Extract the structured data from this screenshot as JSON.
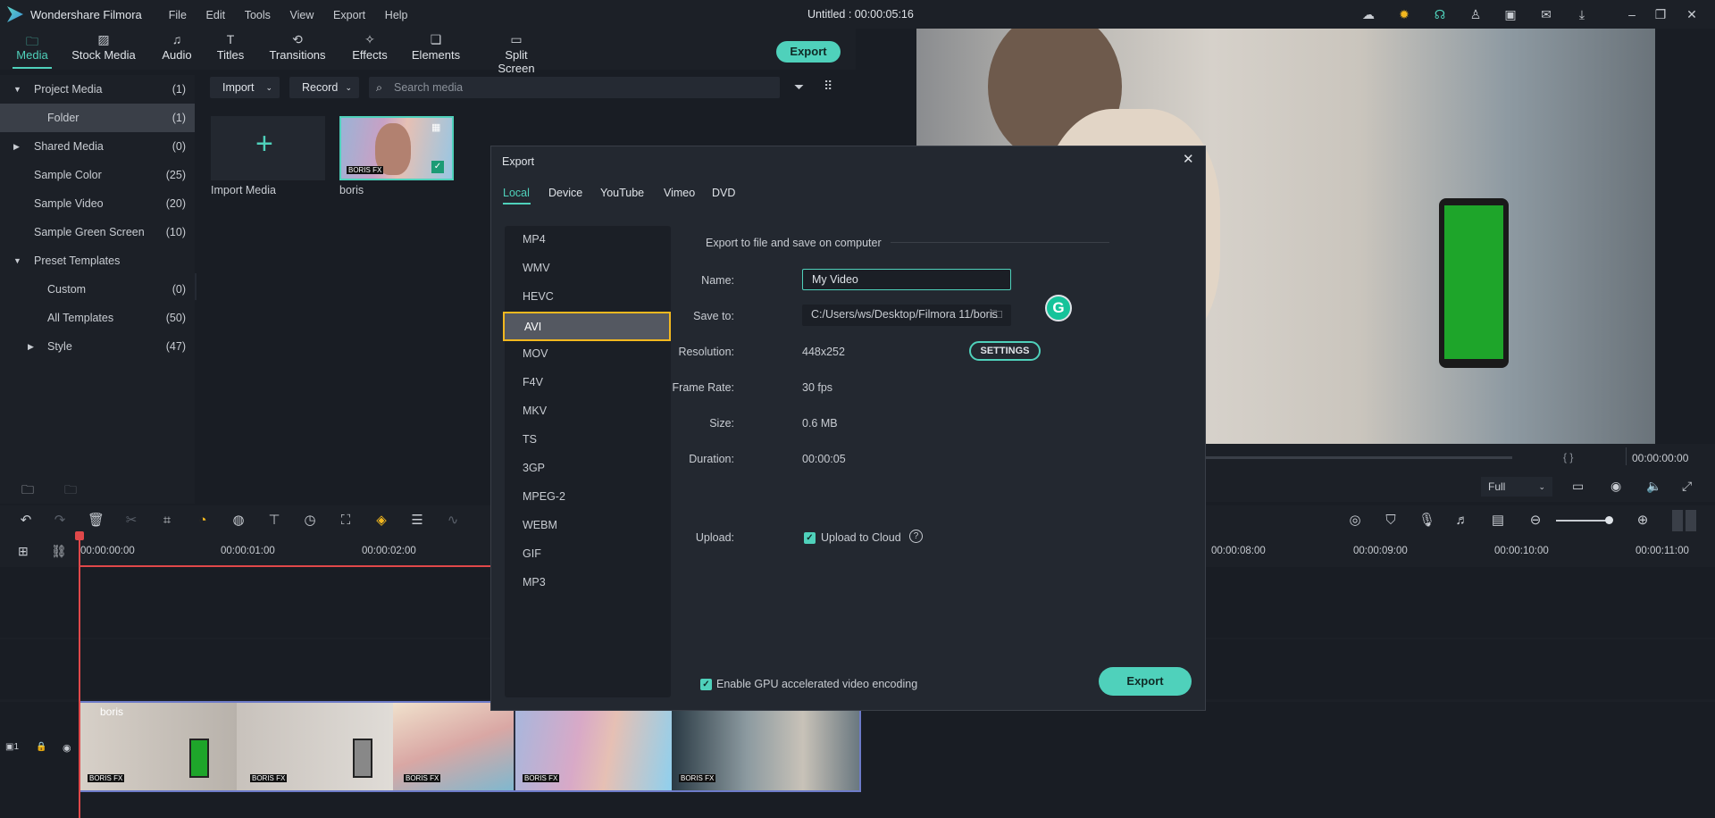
{
  "app": {
    "name": "Wondershare Filmora",
    "doc_title": "Untitled : 00:00:05:16",
    "menu": [
      "File",
      "Edit",
      "Tools",
      "View",
      "Export",
      "Help"
    ]
  },
  "top_tabs": [
    {
      "label": "Media",
      "icon": "folder-icon"
    },
    {
      "label": "Stock Media",
      "icon": "stock-media-icon"
    },
    {
      "label": "Audio",
      "icon": "music-note-icon"
    },
    {
      "label": "Titles",
      "icon": "text-t-icon"
    },
    {
      "label": "Transitions",
      "icon": "transitions-icon"
    },
    {
      "label": "Effects",
      "icon": "effects-icon"
    },
    {
      "label": "Elements",
      "icon": "elements-icon"
    },
    {
      "label": "Split Screen",
      "icon": "split-screen-icon"
    }
  ],
  "export_button": "Export",
  "sidebar": {
    "items": [
      {
        "label": "Project Media",
        "count": "(1)"
      },
      {
        "label": "Folder",
        "count": "(1)"
      },
      {
        "label": "Shared Media",
        "count": "(0)"
      },
      {
        "label": "Sample Color",
        "count": "(25)"
      },
      {
        "label": "Sample Video",
        "count": "(20)"
      },
      {
        "label": "Sample Green Screen",
        "count": "(10)"
      },
      {
        "label": "Preset Templates",
        "count": ""
      },
      {
        "label": "Custom",
        "count": "(0)"
      },
      {
        "label": "All Templates",
        "count": "(50)"
      },
      {
        "label": "Style",
        "count": "(47)"
      }
    ]
  },
  "media": {
    "import_label": "Import",
    "record_label": "Record",
    "search_placeholder": "Search media",
    "import_media_label": "Import Media",
    "clip_name": "boris"
  },
  "preview": {
    "timecode": "00:00:00:00",
    "zoom": "Full",
    "brackets": "{    }"
  },
  "ruler": {
    "ticks": [
      "00:00:00:00",
      "00:00:01:00",
      "00:00:02:00",
      "00:00:08:00",
      "00:00:09:00",
      "00:00:10:00",
      "00:00:11:00"
    ]
  },
  "timeline": {
    "clip_name": "boris",
    "track_number": "1",
    "boris_fx": "BORIS FX"
  },
  "dialog": {
    "title": "Export",
    "tabs": [
      "Local",
      "Device",
      "YouTube",
      "Vimeo",
      "DVD"
    ],
    "formats": [
      "MP4",
      "WMV",
      "HEVC",
      "AVI",
      "MOV",
      "F4V",
      "MKV",
      "TS",
      "3GP",
      "MPEG-2",
      "WEBM",
      "GIF",
      "MP3"
    ],
    "selected_format": "AVI",
    "section_heading": "Export to file and save on computer",
    "name_label": "Name:",
    "name_value": "My Video",
    "save_label": "Save to:",
    "save_value": "C:/Users/ws/Desktop/Filmora 11/boris",
    "resolution_label": "Resolution:",
    "resolution_value": "448x252",
    "settings_button": "SETTINGS",
    "framerate_label": "Frame Rate:",
    "framerate_value": "30 fps",
    "size_label": "Size:",
    "size_value": "0.6 MB",
    "duration_label": "Duration:",
    "duration_value": "00:00:05",
    "upload_label": "Upload:",
    "upload_cloud": "Upload to Cloud",
    "gpu_label": "Enable GPU accelerated video encoding",
    "export_button": "Export",
    "grammarly_letter": "G"
  }
}
